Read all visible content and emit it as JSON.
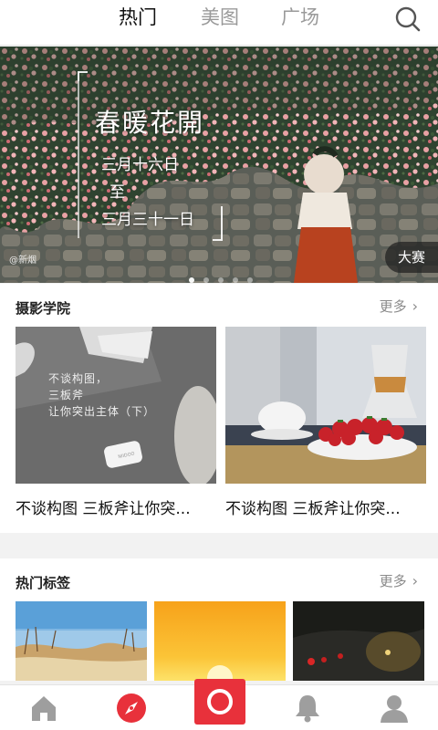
{
  "tabs": [
    {
      "label": "热门",
      "active": true
    },
    {
      "label": "美图",
      "active": false
    },
    {
      "label": "广场",
      "active": false
    }
  ],
  "banner": {
    "title": "春暖花開",
    "line1": "三月十六日",
    "line2": "至",
    "line3": "三月三十一日",
    "credit": "@新烟",
    "badge": "大赛",
    "slides_total": 5,
    "active_slide": 1
  },
  "academy": {
    "heading": "摄影学院",
    "more": "更多",
    "cards": [
      {
        "title": "不谈构图 三板斧让你突...",
        "caption": [
          "不谈构图，",
          "三板斧",
          "让你突出主体（下）"
        ]
      },
      {
        "title": "不谈构图 三板斧让你突..."
      }
    ]
  },
  "hot_tags": {
    "heading": "热门标签",
    "more": "更多"
  },
  "colors": {
    "accent": "#e8313b",
    "tab_active": "#111111",
    "tab_inactive": "#9a9a9a"
  },
  "nav_icons": [
    "home-icon",
    "compass-icon",
    "camera-icon",
    "bell-icon",
    "user-icon"
  ]
}
